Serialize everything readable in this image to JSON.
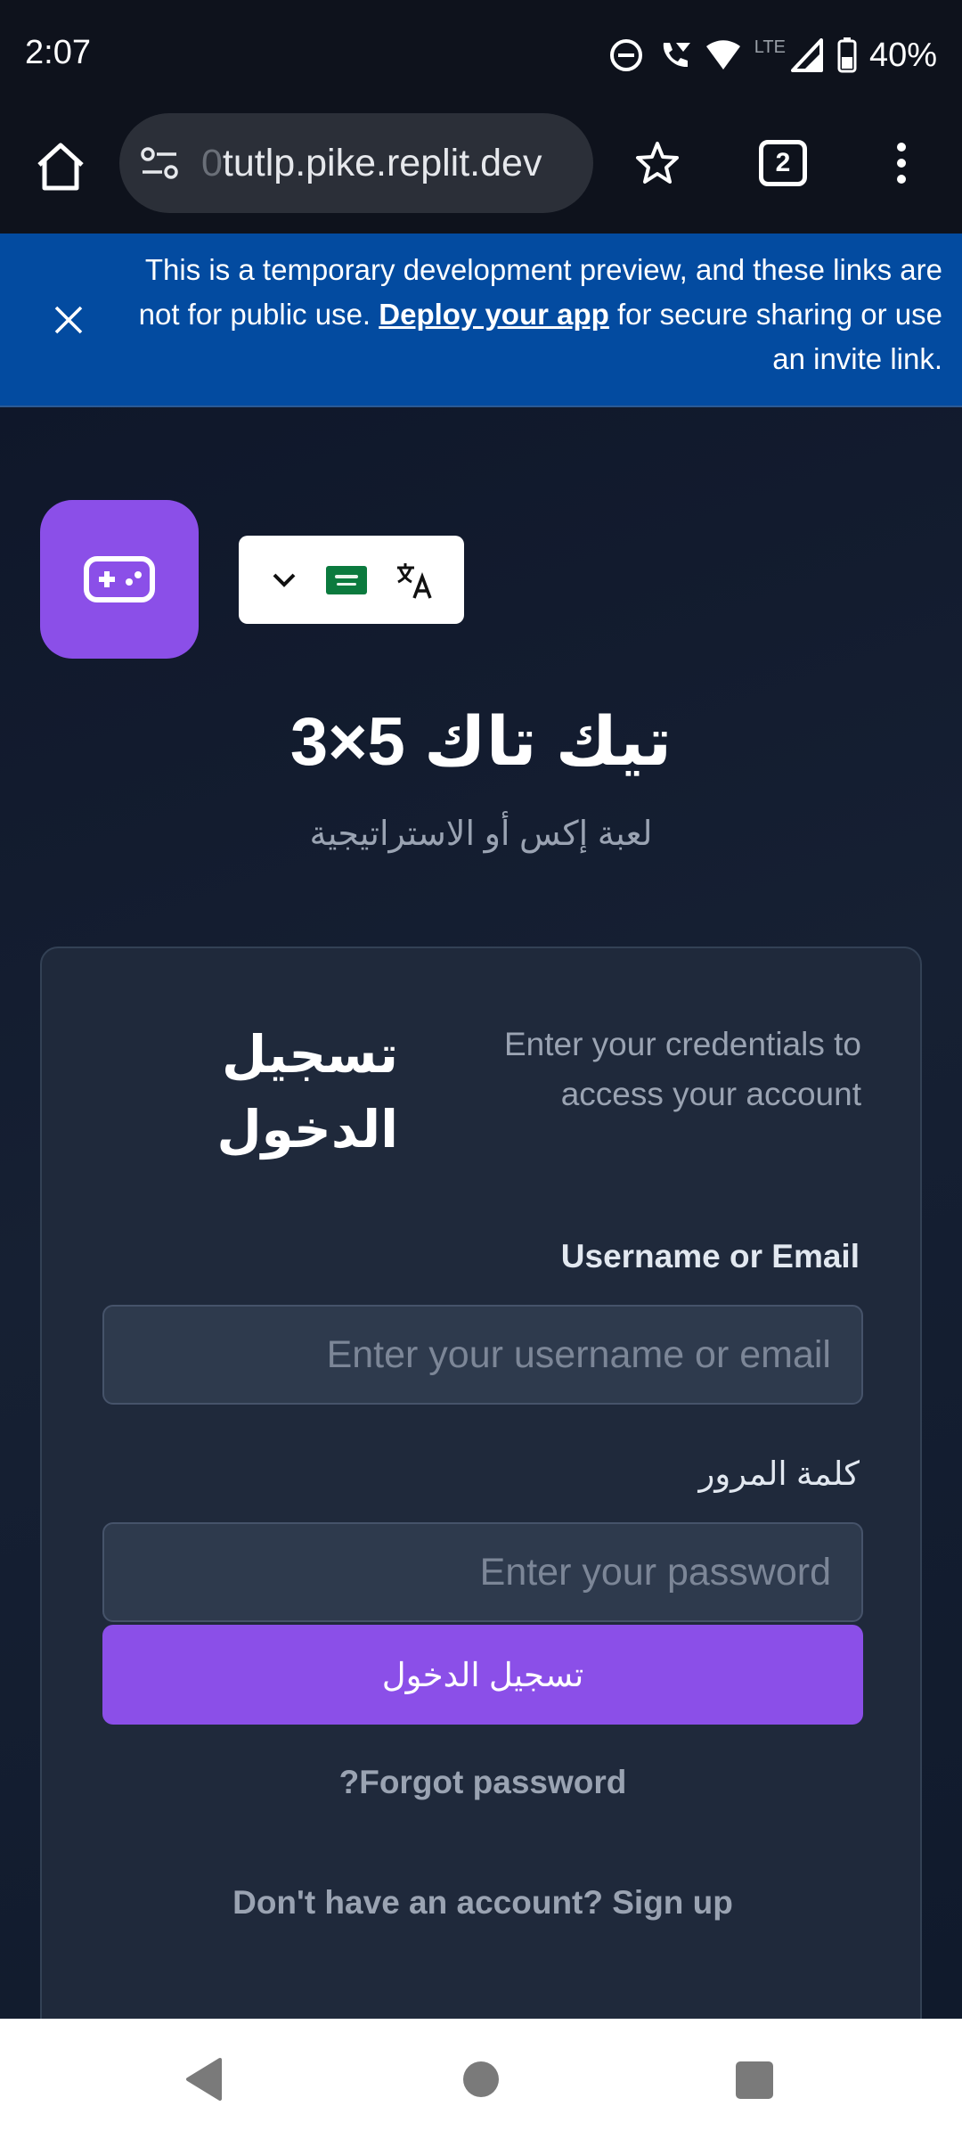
{
  "status_bar": {
    "time": "2:07",
    "network": "LTE",
    "battery": "40%",
    "icons": [
      "dnd-icon",
      "wifi-calling-icon",
      "wifi-icon",
      "signal-icon",
      "battery-icon"
    ]
  },
  "browser": {
    "url_faded": "0",
    "url": "tutlp.pike.replit.dev",
    "tab_count": "2",
    "icons": [
      "home-icon",
      "site-settings-icon",
      "star-icon",
      "tabs-icon",
      "more-icon"
    ]
  },
  "dev_banner": {
    "text_before": "This is a temporary development preview, and these links are not for public use. ",
    "link": "Deploy your app",
    "text_after": " for secure sharing or use an invite link."
  },
  "app": {
    "title": "تيك تاك 5×3",
    "subtitle": "لعبة إكس أو الاستراتيجية",
    "accent_color": "#8b4fe8"
  },
  "login": {
    "title": "تسجيل الدخول",
    "description": "Enter your credentials to access your account",
    "username_label": "Username or Email",
    "username_placeholder": "Enter your username or email",
    "password_label": "كلمة المرور",
    "password_placeholder": "Enter your password",
    "submit_label": "تسجيل الدخول",
    "forgot_label": "Forgot password?",
    "signup_label": "Don't have an account? Sign up"
  }
}
